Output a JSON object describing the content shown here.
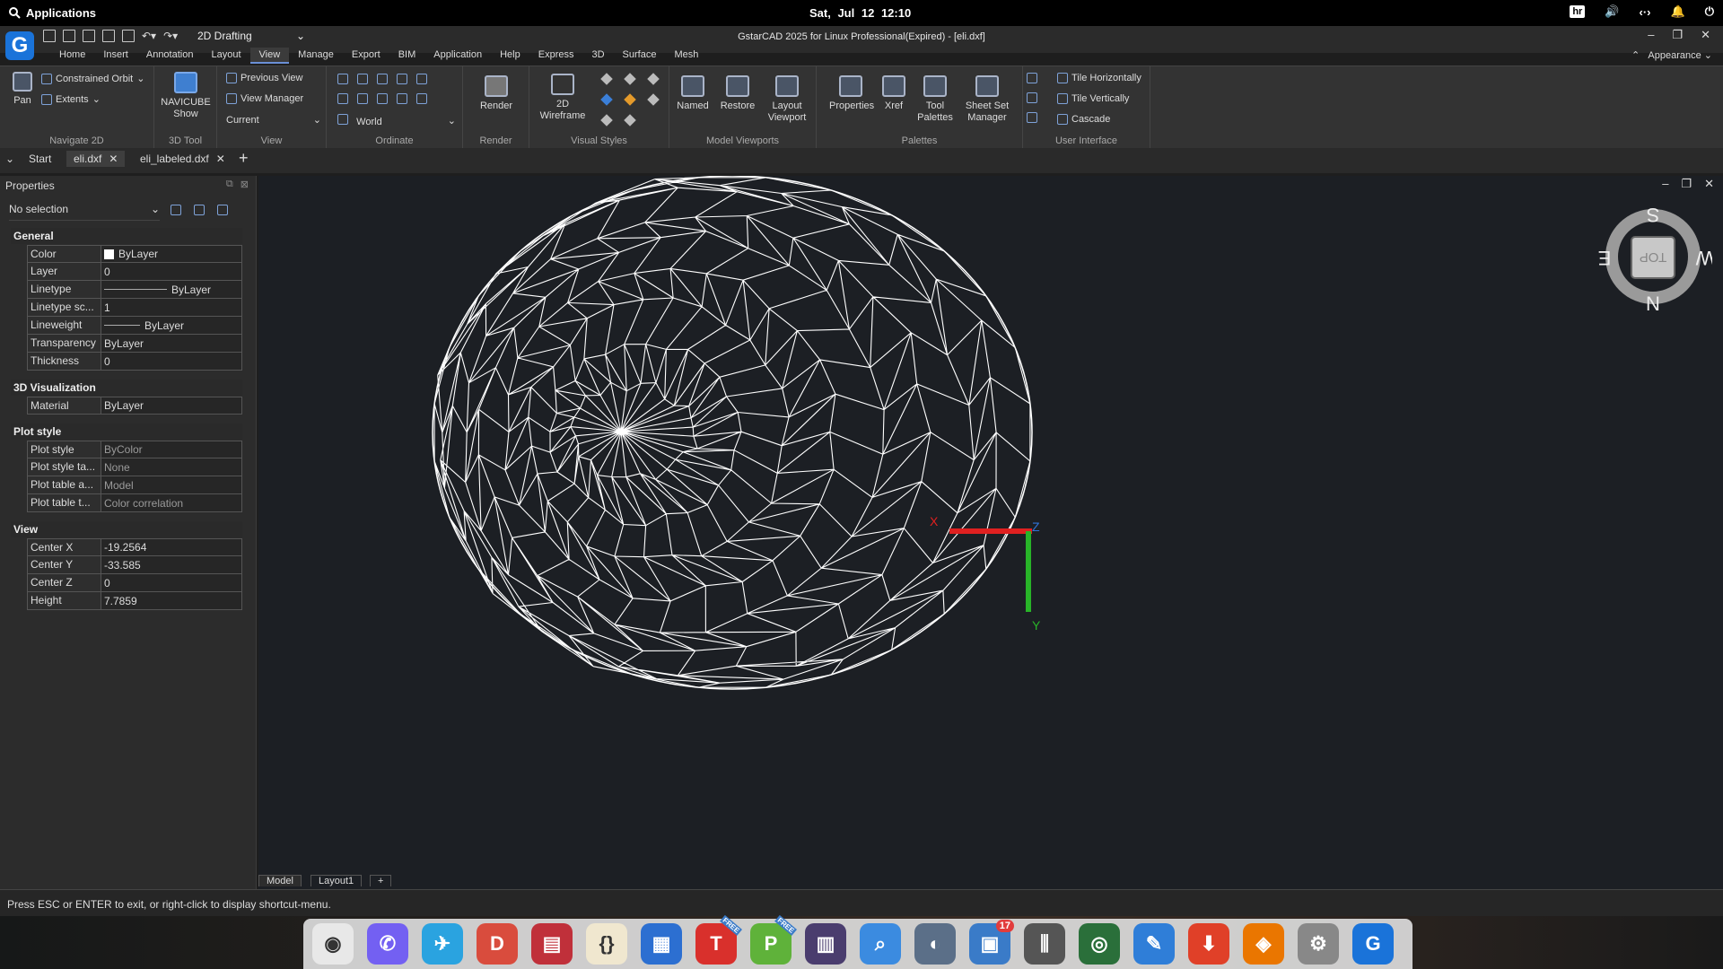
{
  "system_bar": {
    "apps_label": "Applications",
    "date": "Sat, Jul 12",
    "time": "12:10",
    "keyboard_layout": "hr"
  },
  "window": {
    "title": "GstarCAD 2025 for Linux Professional(Expired) - [eli.dxf]",
    "workspace": "2D Drafting",
    "app_logo": "G"
  },
  "menu_tabs": [
    "Home",
    "Insert",
    "Annotation",
    "Layout",
    "View",
    "Manage",
    "Export",
    "BIM",
    "Application",
    "Help",
    "Express",
    "3D",
    "Surface",
    "Mesh"
  ],
  "active_menu_tab": "View",
  "appearance_label": "Appearance",
  "ribbon": {
    "navigate2d": {
      "name": "Navigate 2D",
      "pan": "Pan",
      "orbit": "Constrained Orbit",
      "extents": "Extents"
    },
    "tool3d": {
      "name": "3D Tool",
      "navicube": "NAVICUBE",
      "show": "Show"
    },
    "view": {
      "name": "View",
      "previous": "Previous View",
      "manager": "View Manager",
      "current": "Current"
    },
    "ordinate": {
      "name": "Ordinate",
      "world": "World"
    },
    "render": {
      "name": "Render",
      "label": "Render"
    },
    "visual_styles": {
      "name": "Visual Styles",
      "wireframe": "2D Wireframe"
    },
    "model_viewports": {
      "name": "Model Viewports",
      "named": "Named",
      "restore": "Restore",
      "layout_line1": "Layout",
      "layout_line2": "Viewport"
    },
    "palettes": {
      "name": "Palettes",
      "properties": "Properties",
      "xref": "Xref",
      "tool_line1": "Tool",
      "tool_line2": "Palettes",
      "sheet_line1": "Sheet Set",
      "sheet_line2": "Manager"
    },
    "user_interface": {
      "name": "User Interface",
      "tile_h": "Tile Horizontally",
      "tile_v": "Tile Vertically",
      "cascade": "Cascade"
    }
  },
  "doc_tabs": {
    "start": "Start",
    "tab1": "eli.dxf",
    "tab2": "eli_labeled.dxf"
  },
  "properties": {
    "header": "Properties",
    "selection": "No selection",
    "general": {
      "title": "General",
      "rows": [
        [
          "Color",
          "ByLayer"
        ],
        [
          "Layer",
          "0"
        ],
        [
          "Linetype",
          "ByLayer"
        ],
        [
          "Linetype sc...",
          "1"
        ],
        [
          "Lineweight",
          "ByLayer"
        ],
        [
          "Transparency",
          "ByLayer"
        ],
        [
          "Thickness",
          "0"
        ]
      ]
    },
    "viz": {
      "title": "3D Visualization",
      "rows": [
        [
          "Material",
          "ByLayer"
        ]
      ]
    },
    "plot": {
      "title": "Plot style",
      "rows": [
        [
          "Plot style",
          "ByColor"
        ],
        [
          "Plot style ta...",
          "None"
        ],
        [
          "Plot table a...",
          "Model"
        ],
        [
          "Plot table t...",
          "Color correlation"
        ]
      ]
    },
    "view": {
      "title": "View",
      "rows": [
        [
          "Center X",
          "-19.2564"
        ],
        [
          "Center Y",
          "-33.585"
        ],
        [
          "Center Z",
          "0"
        ],
        [
          "Height",
          "7.7859"
        ]
      ]
    }
  },
  "navcube": {
    "top": "TOP",
    "n": "N",
    "s": "S",
    "e": "E",
    "w": "W"
  },
  "ucs": {
    "x": "X",
    "y": "Y",
    "z": "Z"
  },
  "layout_tabs": [
    "Model",
    "Layout1",
    "+"
  ],
  "command_line": "Press ESC or ENTER to exit, or right-click to display shortcut-menu.",
  "dock": {
    "notification_count": "17",
    "free_label": "FREE",
    "icons": [
      "chrome-icon",
      "viber-icon",
      "telegram-icon",
      "office-icon",
      "terminal-icon",
      "brackets-icon",
      "writer-icon",
      "t-app-icon",
      "p-app-icon",
      "server-icon",
      "search-icon",
      "toggle-icon",
      "software-store-icon",
      "mixer-icon",
      "camera-icon",
      "pen-icon",
      "downloader-icon",
      "blender-icon",
      "settings-icon",
      "gstarcad-icon"
    ]
  }
}
